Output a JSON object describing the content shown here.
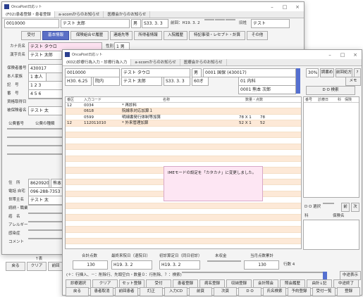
{
  "back": {
    "title": "OncaPost日応ット",
    "tabs": [
      "(F02)患者登録・患者登録",
      "a-scomからのお知らせ",
      "医療会からのお知らせ"
    ],
    "patient_id": "0010000",
    "name": "テスト 太郎",
    "sex": "男",
    "birth": "S33. 3. 3",
    "prev_visit": "前回：H19. 3. 2",
    "old_name_label": "旧姓",
    "old_name": "テスト",
    "subtabs": [
      "受付",
      "基本情報",
      "保険組合せ履歴",
      "連絡先等",
      "所得者情報",
      "入院履歴",
      "特記事項・レセプト・計算",
      "その他"
    ],
    "kana_label": "カナ氏名",
    "kana": "テスト タウロ",
    "seibetsu_label": "性別",
    "seibetsu": "1 男",
    "kanji_label": "漢字氏名",
    "kanji": "テスト 太郎",
    "rows": [
      {
        "label": "保険者番号",
        "value": "430017"
      },
      {
        "label": "本人家族",
        "value": "1 本人"
      },
      {
        "label": "記　号",
        "value": "1 2 3"
      },
      {
        "label": "番　号",
        "value": "4 5 6"
      },
      {
        "label": "資格取得日",
        "value": ""
      },
      {
        "label": "被保険者名",
        "value": "テスト 太"
      }
    ],
    "kohi_label": "公費番号",
    "kohi_header": "公費の種類",
    "addr_label": "住　所",
    "zip": "8620920",
    "addr": "熊本",
    "tel_label": "電話 自宅",
    "tel": "096-288-7353",
    "seho_label": "世帯主名",
    "seho": "テスト 太",
    "other_labels": [
      "続柄・職業",
      "癌　名",
      "アレルギー",
      "感染症",
      "コメント"
    ],
    "bottom_keys": [
      "戻る",
      "クリア",
      "前回"
    ],
    "bottom_fkey": "↑表"
  },
  "front": {
    "title": "OncaPost日応ット",
    "tabs": [
      "(K02)診療行為入力・診療行為入力",
      "a-scomからのお知らせ",
      "医療会からのお知らせ"
    ],
    "patient_id": "0010000",
    "kana": "テスト タウロ",
    "sex": "男",
    "insurance": "0001 国保 (430017)",
    "ratio": "30%",
    "btn_chosho": "調書め",
    "btn_prev": "前回処方",
    "btn_q": "?",
    "date": "H30. 6.25",
    "inout": "院内",
    "name": "テスト 太郎",
    "birth": "S33. 3. 3",
    "age": "60才",
    "dept": "01 内科",
    "memo": "メモ",
    "doctor": "0001 熊本 次郎",
    "search_btn": "D O 検索",
    "grid_headers": [
      "番区",
      "入力コード",
      "名称",
      "数量・点数"
    ],
    "grid_rows": [
      {
        "kubun": "12",
        "code": "0034",
        "name": "* 再診料",
        "qty": ""
      },
      {
        "kubun": "",
        "code": "0618",
        "name": "院線系対応加算１",
        "qty": ""
      },
      {
        "kubun": "",
        "code": "0599",
        "name": "明細書発行体制等加算",
        "qty": "78 X 1"
      },
      {
        "kubun": "12",
        "code": "112011010",
        "name": "* 外来管理加算",
        "qty": "52 X 1"
      }
    ],
    "grid_points": [
      "",
      "",
      "78",
      "52"
    ],
    "popup": "IMEモードの設定を「カタカナ」に変更しました。",
    "side_headers": [
      "番号",
      "診療日",
      "科",
      "保険"
    ],
    "do_select": "D O 選択",
    "side_prev": "前",
    "side_next": "次",
    "side_ka": "科",
    "side_hoken": "保険名",
    "sum_labels": [
      "合計点数",
      "最終来院日（退院日）",
      "初診算定日（同日初診）",
      "未収金",
      "当月点数累計"
    ],
    "sum_values": [
      "130",
      "H19. 3. 2",
      "H19. 3. 2",
      "",
      "130"
    ],
    "row_count": "行数 4",
    "hint": "(＋：行挿入、－：削除行、先頭空白・数量０：行削除、？：検索)",
    "chudan": "中途表示",
    "fkeys1": [
      "診療選択",
      "クリア",
      "セット登録",
      "受付",
      "患者登録",
      "病名登録",
      "収納登録",
      "会計照会",
      "照会履歴",
      "由計↓記",
      "中途終了"
    ],
    "fkeys2": [
      "戻る",
      "患者取消",
      "前回患者",
      "訂正",
      "入力CD",
      "前頁",
      "次頁",
      "D O",
      "氏名検索",
      "予約登録",
      "受付一覧",
      "登録"
    ]
  }
}
